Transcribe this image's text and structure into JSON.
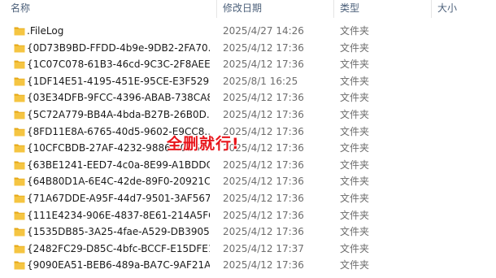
{
  "columns": {
    "name": "名称",
    "date": "修改日期",
    "type": "类型",
    "size": "大小"
  },
  "folder_icon": "folder-icon",
  "folder_color": "#f5c542",
  "files": [
    {
      "name": ".FileLog",
      "date": "2025/4/27 14:26",
      "type": "文件夹"
    },
    {
      "name": "{0D73B9BD-FFDD-4b9e-9DB2-2FA70...",
      "date": "2025/4/12 17:36",
      "type": "文件夹"
    },
    {
      "name": "{1C07C078-61B3-46cd-9C3C-2F8AEE...",
      "date": "2025/4/12 17:36",
      "type": "文件夹"
    },
    {
      "name": "{1DF14E51-4195-451E-95CE-E3F5295...",
      "date": "2025/8/1 16:25",
      "type": "文件夹"
    },
    {
      "name": "{03E34DFB-9FCC-4396-ABAB-738CA8...",
      "date": "2025/4/12 17:36",
      "type": "文件夹"
    },
    {
      "name": "{5C72A779-BB4A-4bda-B27B-26B0D...",
      "date": "2025/4/12 17:36",
      "type": "文件夹"
    },
    {
      "name": "{8FD11E8A-6765-40d5-9602-E9CC8...",
      "date": "2025/4/12 17:36",
      "type": "文件夹"
    },
    {
      "name": "{10CFCBDB-27AF-4232-9886-40D56...",
      "date": "2025/4/12 17:36",
      "type": "文件夹"
    },
    {
      "name": "{63BE1241-EED7-4c0a-8E99-A1BDDC...",
      "date": "2025/4/12 17:36",
      "type": "文件夹"
    },
    {
      "name": "{64B80D1A-6E4C-42de-89F0-20921C...",
      "date": "2025/4/12 17:36",
      "type": "文件夹"
    },
    {
      "name": "{71A67DDE-A95F-44d7-9501-3AF567...",
      "date": "2025/4/12 17:36",
      "type": "文件夹"
    },
    {
      "name": "{111E4234-906E-4837-8E61-214A5FC...",
      "date": "2025/4/12 17:36",
      "type": "文件夹"
    },
    {
      "name": "{1535DB85-3A25-4fae-A529-DB3905...",
      "date": "2025/4/12 17:36",
      "type": "文件夹"
    },
    {
      "name": "{2482FC29-D85C-4bfc-BCCF-E15DFE1...",
      "date": "2025/4/12 17:37",
      "type": "文件夹"
    },
    {
      "name": "{9090EA51-BEB6-489a-BA7C-9AF21A...",
      "date": "2025/4/12 17:36",
      "type": "文件夹"
    }
  ],
  "overlay_text": "全删就行!",
  "overlay_color": "#e8161c"
}
